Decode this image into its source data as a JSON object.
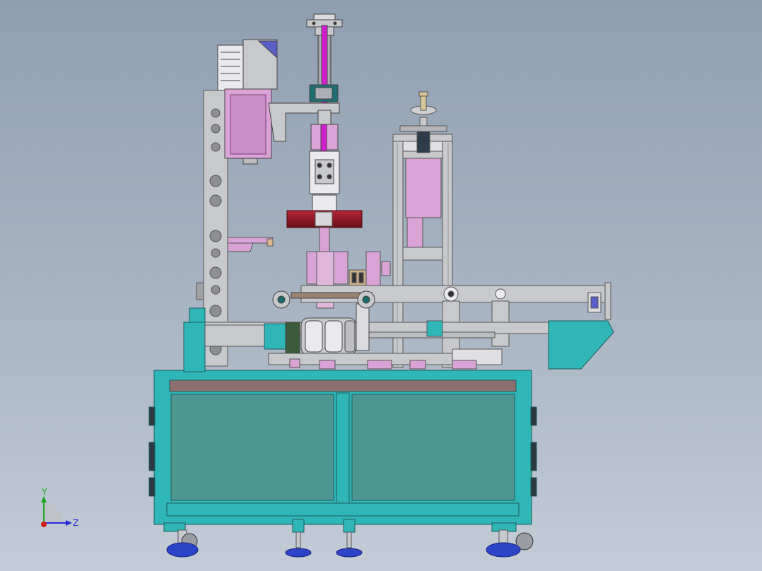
{
  "viewport": {
    "background_top": "#8f9fb2",
    "background_bottom": "#c3ccd6"
  },
  "colors": {
    "frame_cyan": "#2fb6b6",
    "frame_edge": "#1e7f80",
    "panel_teal": "#4f9590",
    "top_plate": "#8d6f6e",
    "part_pink": "#d9a3d6",
    "part_magenta": "#d21ed0",
    "part_gray": "#c8c9cc",
    "disk_red": "#8e1b26",
    "foot_blue": "#2d43c8"
  },
  "triad": {
    "y_label": "Y",
    "z_label": "Z",
    "y_axis_color": "#1fa51f",
    "z_axis_color": "#2a2ad8",
    "x_axis_color": "#d01b1b"
  }
}
